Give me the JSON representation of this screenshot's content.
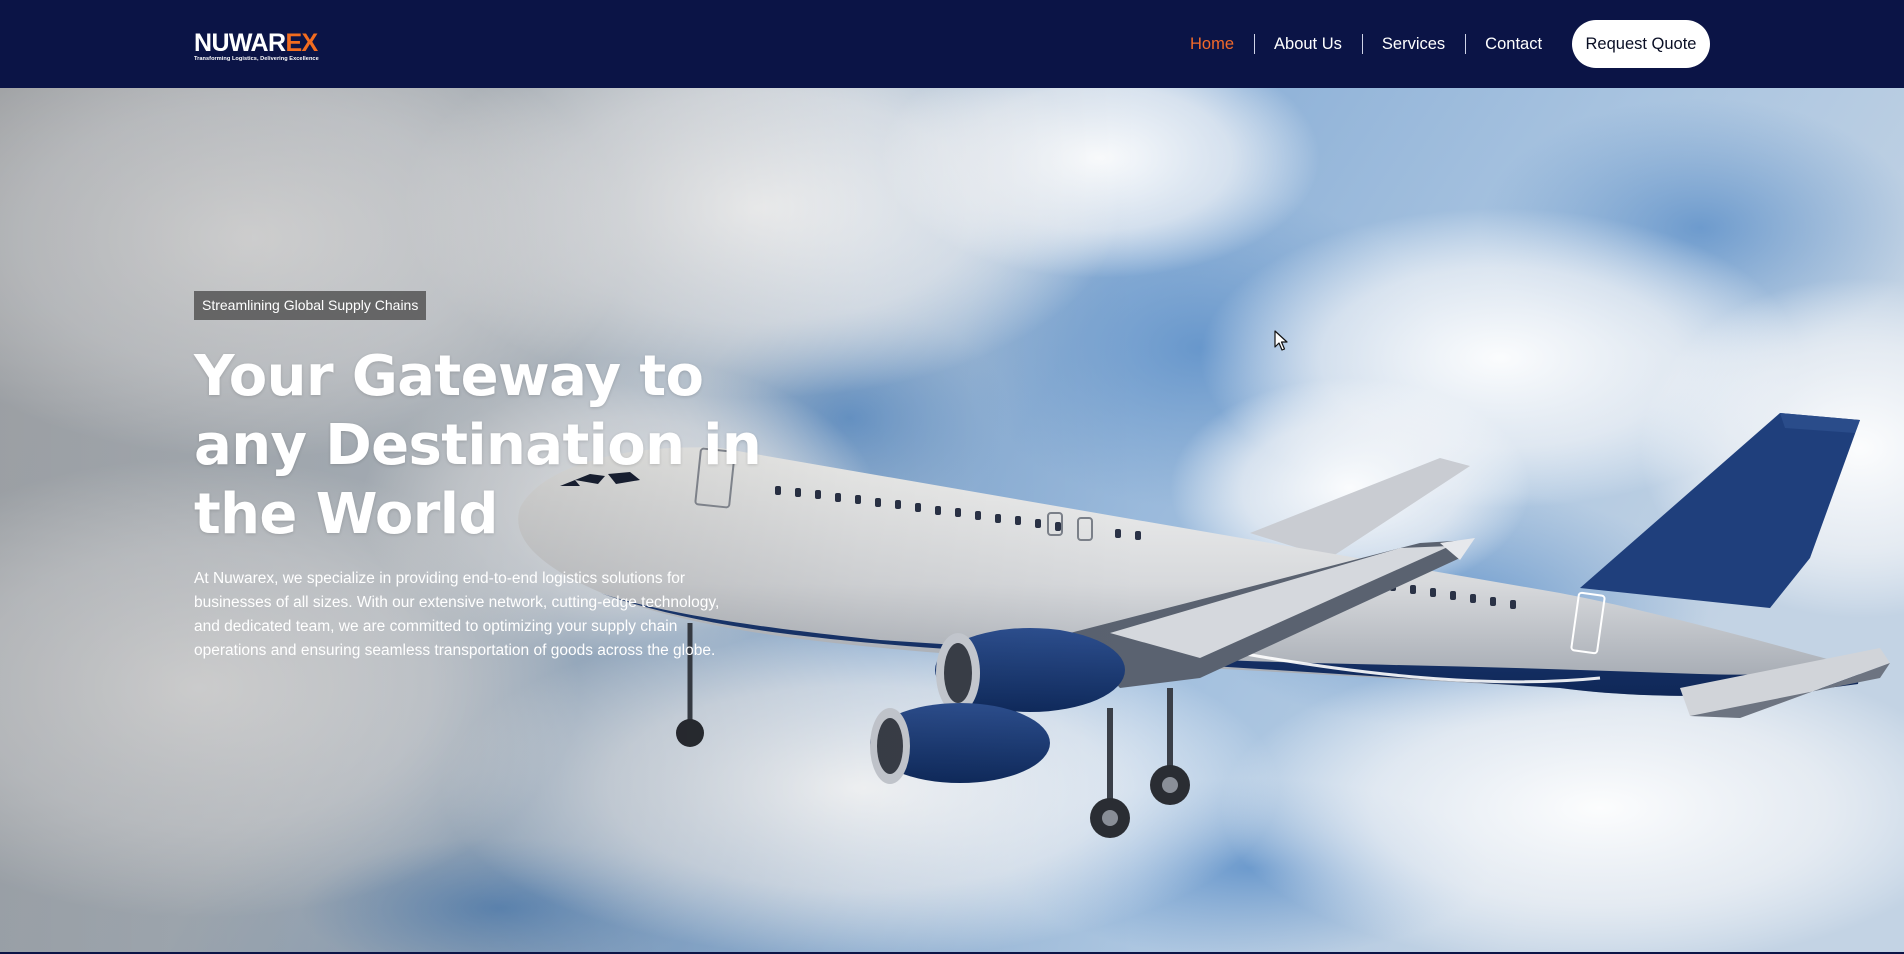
{
  "brand": {
    "name_part1": "NUWAR",
    "name_part2": "EX",
    "tagline": "Transforming Logistics, Delivering Excellence",
    "primary_color": "#0b1446",
    "accent_color": "#f26c1f"
  },
  "nav": {
    "items": [
      {
        "label": "Home",
        "active": true
      },
      {
        "label": "About Us",
        "active": false
      },
      {
        "label": "Services",
        "active": false
      },
      {
        "label": "Contact",
        "active": false
      }
    ],
    "cta_label": "Request Quote"
  },
  "hero": {
    "tag": "Streamlining Global Supply Chains",
    "headline": "Your Gateway to any Destination in the World",
    "description": "At Nuwarex, we specialize in providing end-to-end logistics solutions for businesses of all sizes. With our extensive network, cutting-edge technology, and dedicated team, we are committed to optimizing your supply chain operations and ensuring seamless transportation of goods across the globe.",
    "background_image": "airplane-in-cloudy-sky-photo"
  }
}
